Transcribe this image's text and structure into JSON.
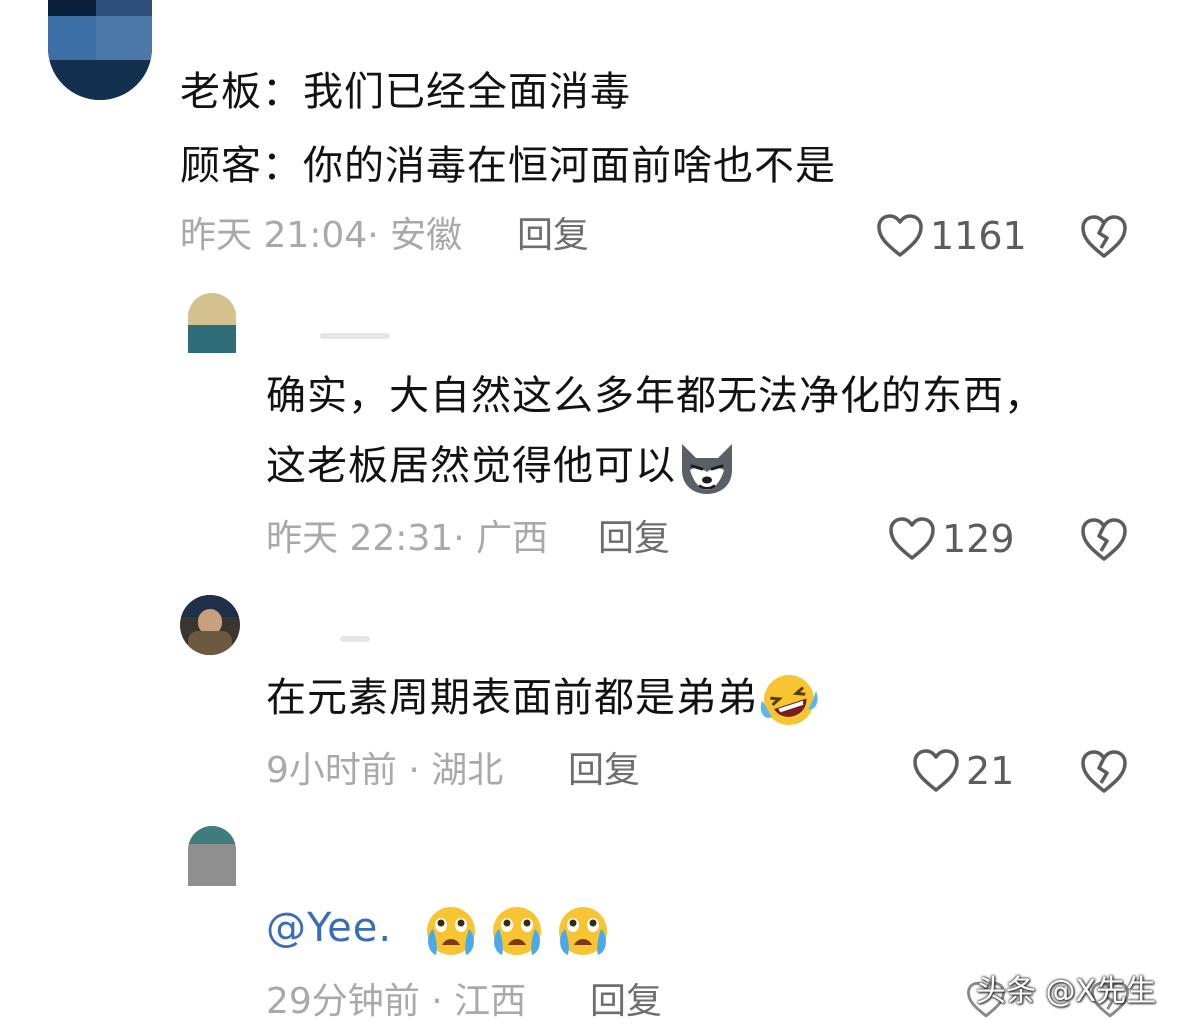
{
  "comments": [
    {
      "lines": [
        "老板：我们已经全面消毒",
        "顾客：你的消毒在恒河面前啥也不是"
      ],
      "meta": "昨天 21:04· 安徽",
      "reply": "回复",
      "likes": "1161"
    },
    {
      "lines": [
        "确实，大自然这么多年都无法净化的东西，",
        "这老板居然觉得他可以"
      ],
      "meta": "昨天 22:31· 广西",
      "reply": "回复",
      "likes": "129"
    },
    {
      "lines": [
        "在元素周期表面前都是弟弟"
      ],
      "meta": "9小时前 · 湖北",
      "reply": "回复",
      "likes": "21"
    },
    {
      "mention": "@Yee.",
      "meta": "29分钟前 · 江西",
      "reply": "回复"
    }
  ],
  "watermark": "头条 @X先生",
  "icons": {
    "like": "heart-outline-icon",
    "dislike": "broken-heart-icon",
    "wolf_emoji": "wolf-smirk-emoji",
    "laugh_cry_emoji": "laughing-crying-emoji",
    "tears_emoji": "crying-face-emoji"
  },
  "colors": {
    "meta": "#a9a9a9",
    "reply": "#6e6e6e",
    "mention": "#3a6db5"
  }
}
